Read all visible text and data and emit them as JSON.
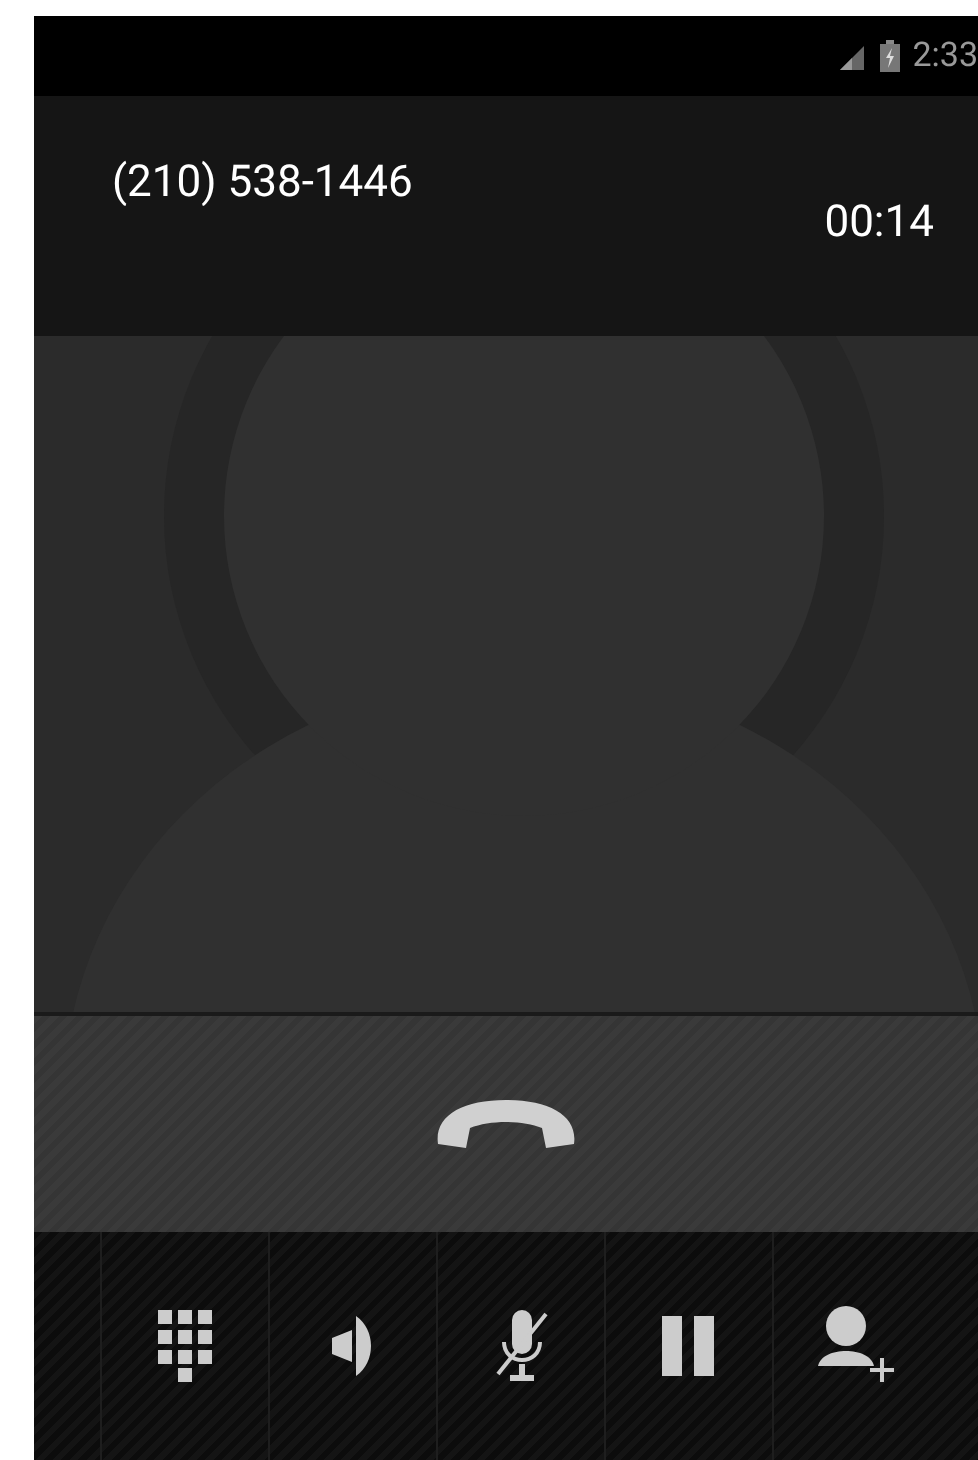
{
  "status_bar": {
    "time": "2:33"
  },
  "call": {
    "number": "(210) 538-1446",
    "duration": "00:14"
  },
  "controls": [
    {
      "kind": "dialpad"
    },
    {
      "kind": "speaker"
    },
    {
      "kind": "mute"
    },
    {
      "kind": "hold"
    },
    {
      "kind": "add_call"
    }
  ]
}
